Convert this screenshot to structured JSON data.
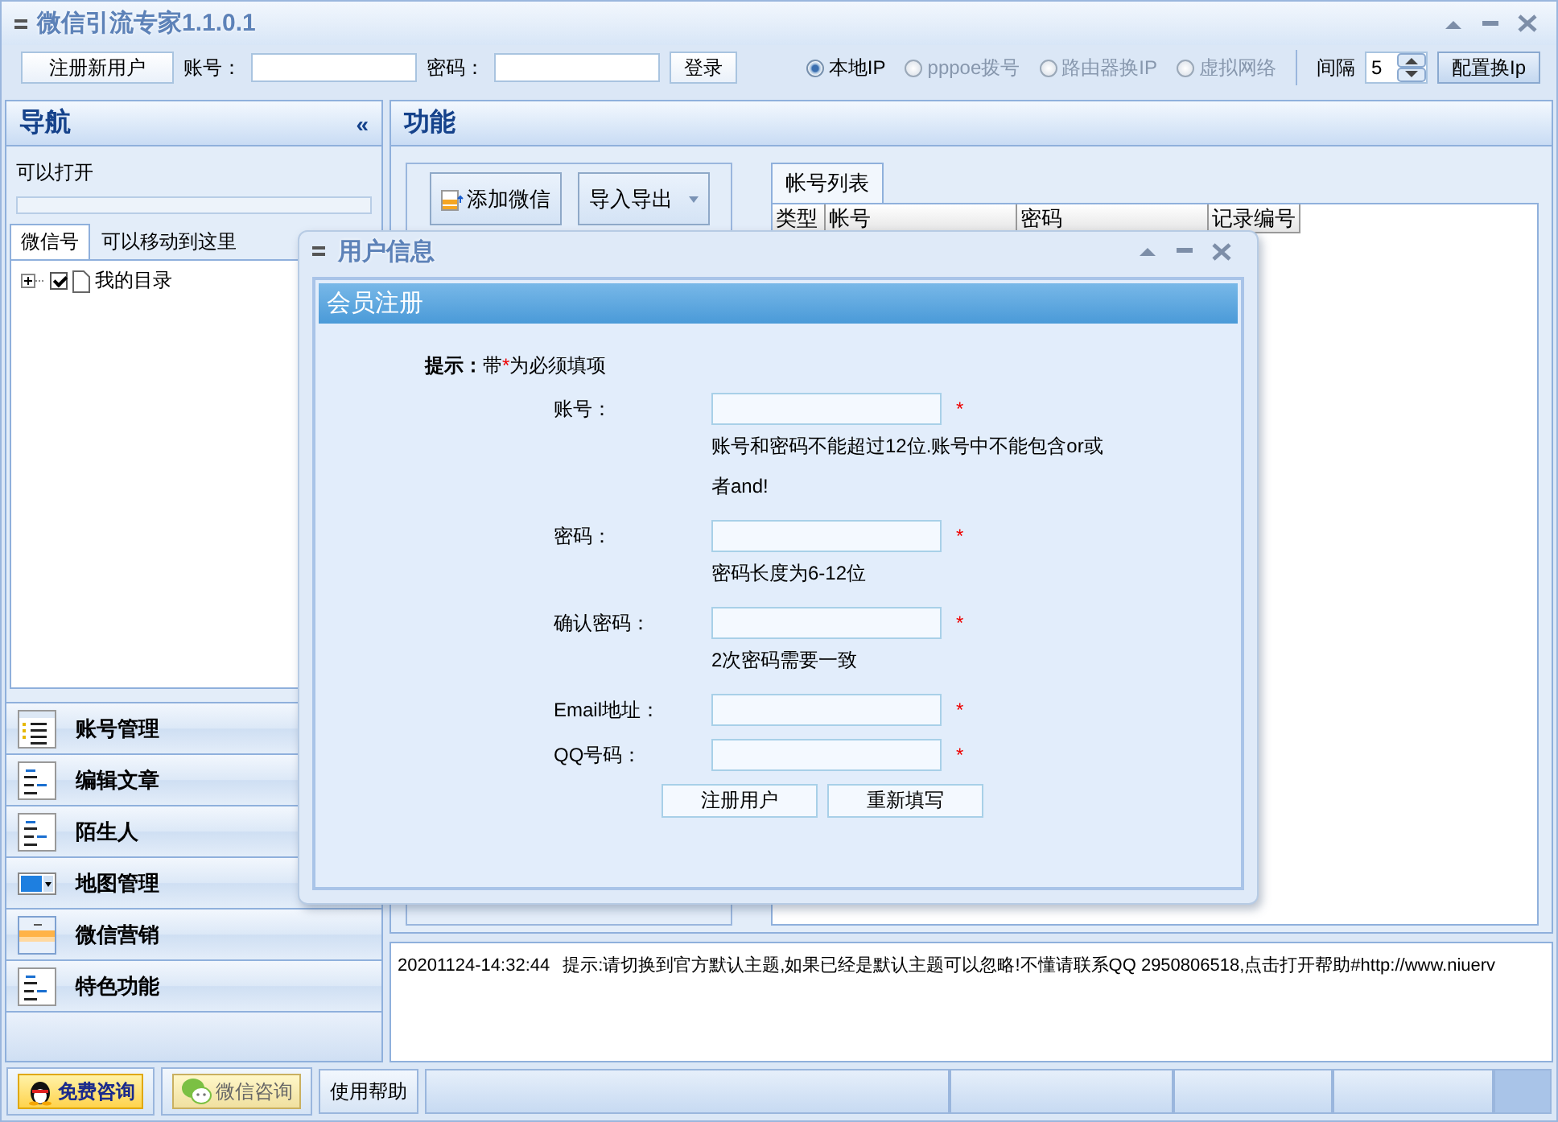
{
  "window": {
    "title": "微信引流专家1.1.0.1"
  },
  "toolbar": {
    "register_button": "注册新用户",
    "account_label": "账号：",
    "password_label": "密码：",
    "login_button": "登录",
    "ip_modes": [
      {
        "label": "本地IP",
        "selected": true,
        "disabled": false
      },
      {
        "label": "pppoe拨号",
        "selected": false,
        "disabled": true
      },
      {
        "label": "路由器换IP",
        "selected": false,
        "disabled": true
      },
      {
        "label": "虚拟网络",
        "selected": false,
        "disabled": true
      }
    ],
    "interval_label": "间隔",
    "interval_value": "5",
    "config_button": "配置换Ip"
  },
  "nav": {
    "title": "导航",
    "collapse": "«",
    "status": "可以打开",
    "progress": {
      "level": 0
    },
    "tabs": [
      {
        "label": "微信号",
        "selected": true
      },
      {
        "label": "可以移动到这里",
        "selected": false
      }
    ],
    "tree": [
      {
        "label": "我的目录",
        "checked": true,
        "expanded": false
      }
    ],
    "items": [
      {
        "label": "账号管理",
        "kind": "list"
      },
      {
        "label": "编辑文章",
        "kind": "form"
      },
      {
        "label": "陌生人",
        "kind": "form"
      },
      {
        "label": "地图管理",
        "kind": "dropdown"
      },
      {
        "label": "微信营销",
        "kind": "bars"
      },
      {
        "label": "特色功能",
        "kind": "form"
      }
    ]
  },
  "function": {
    "title": "功能",
    "buttons": [
      {
        "label": "添加微信",
        "kind": "add"
      },
      {
        "label": "导入导出",
        "kind": "dropdown"
      }
    ],
    "tabs": [
      {
        "label": "帐号列表",
        "selected": true
      }
    ],
    "table": {
      "columns": [
        "类型",
        "帐号",
        "密码",
        "记录编号"
      ]
    }
  },
  "log": [
    {
      "time": "20201124-14:32:44",
      "message": "提示:请切换到官方默认主题,如果已经是默认主题可以忽略!不懂请联系QQ 2950806518,点击打开帮助#http://www.niuerv"
    }
  ],
  "status_bar": {
    "buttons": [
      {
        "label": "免费咨询",
        "kind": "qq"
      },
      {
        "label": "微信咨询",
        "kind": "wechat"
      },
      {
        "label": "使用帮助",
        "kind": "plain"
      }
    ]
  },
  "dialog": {
    "title": "用户信息",
    "header": "会员注册",
    "hint": {
      "label": "提示：",
      "before": "带",
      "mark": "*",
      "after": "为必须填项"
    },
    "fields": [
      {
        "label": "账号：",
        "required": true,
        "note": "账号和密码不能超过12位.账号中不能包含or或者and!"
      },
      {
        "label": "密码：",
        "required": true,
        "note": "密码长度为6-12位"
      },
      {
        "label": "确认密码：",
        "required": true,
        "note": "2次密码需要一致"
      },
      {
        "label": "Email地址：",
        "required": true
      },
      {
        "label": "QQ号码：",
        "required": true
      }
    ],
    "buttons": [
      "注册用户",
      "重新填写"
    ]
  }
}
